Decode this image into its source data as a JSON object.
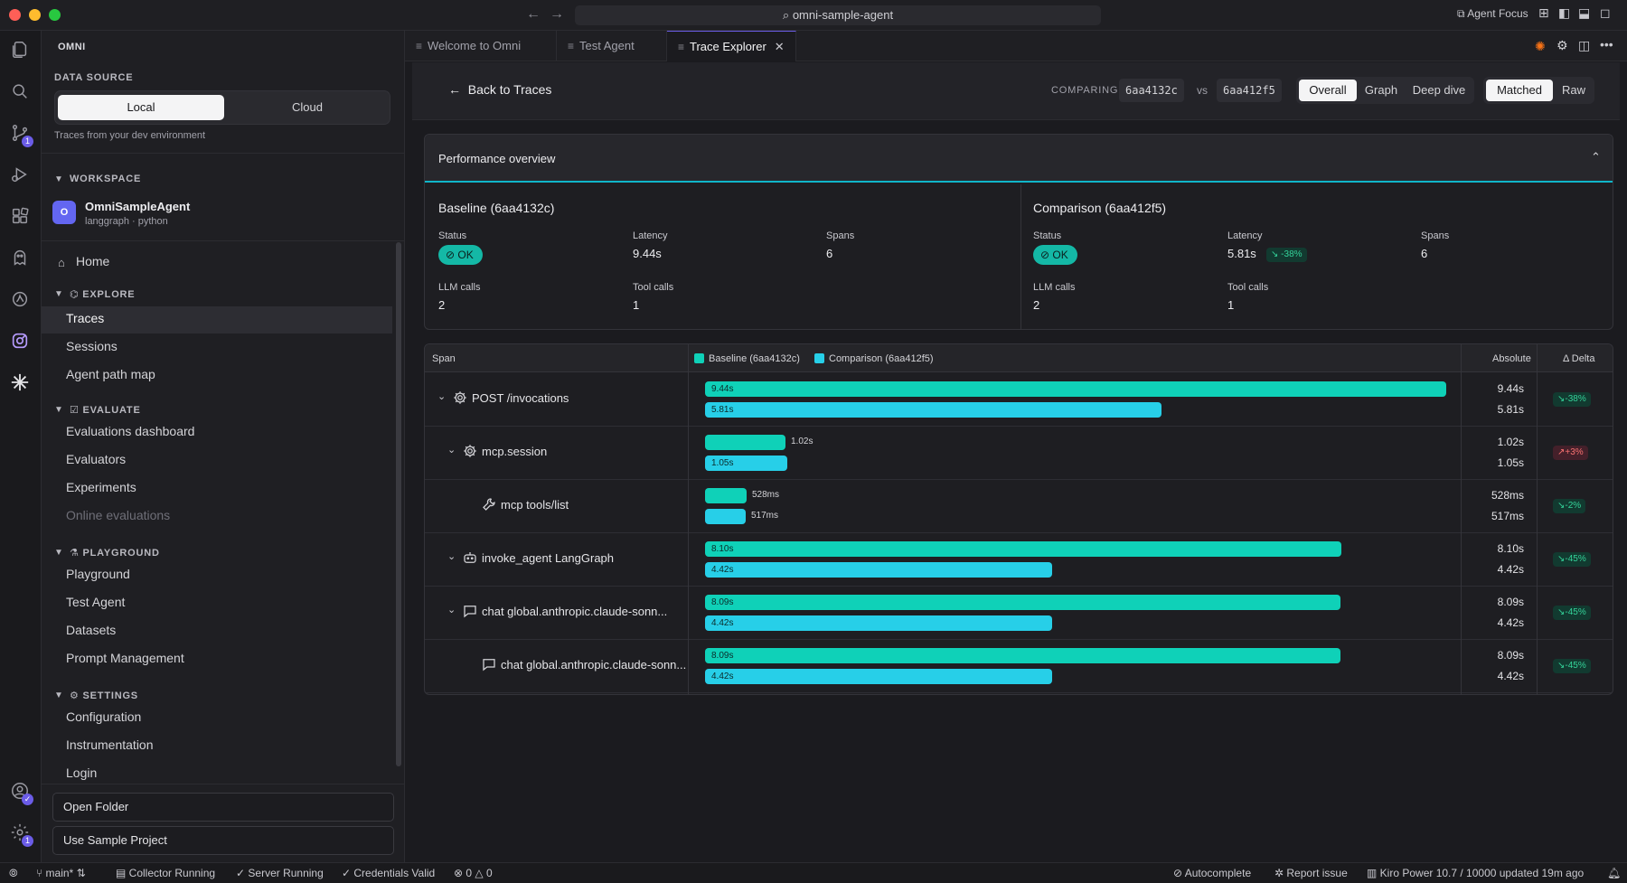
{
  "titlebar": {
    "search": "omni-sample-agent",
    "agent_focus": "Agent Focus"
  },
  "activity": {
    "source_control_badge": "1",
    "settings_badge": "1"
  },
  "sidebar": {
    "title": "OMNI",
    "data_source_label": "DATA SOURCE",
    "local_label": "Local",
    "cloud_label": "Cloud",
    "hint": "Traces from your dev environment",
    "workspace_label": "WORKSPACE",
    "workspace_avatar": "O",
    "workspace_name": "OmniSampleAgent",
    "workspace_sub": "langgraph · python",
    "home": "Home",
    "explore_label": "EXPLORE",
    "explore": [
      "Traces",
      "Sessions",
      "Agent path map"
    ],
    "evaluate_label": "EVALUATE",
    "evaluate": [
      "Evaluations dashboard",
      "Evaluators",
      "Experiments",
      "Online evaluations"
    ],
    "playground_label": "PLAYGROUND",
    "playground": [
      "Playground",
      "Test Agent",
      "Datasets",
      "Prompt Management"
    ],
    "settings_label": "SETTINGS",
    "settings": [
      "Configuration",
      "Instrumentation",
      "Login"
    ],
    "open_folder": "Open Folder",
    "use_sample": "Use Sample Project"
  },
  "tabs": [
    {
      "label": "Welcome to Omni"
    },
    {
      "label": "Test Agent"
    },
    {
      "label": "Trace Explorer"
    }
  ],
  "header": {
    "back": "Back to Traces",
    "comparing": "COMPARING",
    "hash_a": "6aa4132c",
    "vs": "vs",
    "hash_b": "6aa412f5",
    "views": [
      "Overall",
      "Graph",
      "Deep dive"
    ],
    "modes": [
      "Matched",
      "Raw"
    ]
  },
  "performance": {
    "title": "Performance overview",
    "baseline": {
      "title": "Baseline (6aa4132c)",
      "status_label": "Status",
      "status": "OK",
      "latency_label": "Latency",
      "latency": "9.44s",
      "spans_label": "Spans",
      "spans": "6",
      "llm_label": "LLM calls",
      "llm": "2",
      "tool_label": "Tool calls",
      "tool": "1"
    },
    "comparison": {
      "title": "Comparison (6aa412f5)",
      "status_label": "Status",
      "status": "OK",
      "latency_label": "Latency",
      "latency": "5.81s",
      "latency_delta": "-38%",
      "spans_label": "Spans",
      "spans": "6",
      "llm_label": "LLM calls",
      "llm": "2",
      "tool_label": "Tool calls",
      "tool": "1"
    }
  },
  "table": {
    "col_span": "Span",
    "legend_baseline": "Baseline (6aa4132c)",
    "legend_comparison": "Comparison (6aa412f5)",
    "col_absolute": "Absolute",
    "col_delta": "Δ Delta",
    "colors": {
      "baseline": "#0fd1b8",
      "comparison": "#27cfe8"
    },
    "max_seconds": 9.44,
    "rows": [
      {
        "name": "POST /invocations",
        "icon": "gear-icon",
        "indent": 0,
        "expandable": true,
        "base": 9.44,
        "comp": 5.81,
        "base_label": "9.44s",
        "comp_label": "5.81s",
        "delta": "-38%",
        "trend": "down"
      },
      {
        "name": "mcp.session",
        "icon": "gear-icon",
        "indent": 1,
        "expandable": true,
        "base": 1.02,
        "comp": 1.05,
        "base_label": "1.02s",
        "comp_label": "1.05s",
        "delta": "+3%",
        "trend": "up"
      },
      {
        "name": "mcp tools/list",
        "icon": "wrench-icon",
        "indent": 2,
        "expandable": false,
        "base": 0.528,
        "comp": 0.517,
        "base_label": "528ms",
        "comp_label": "517ms",
        "delta": "-2%",
        "trend": "down"
      },
      {
        "name": "invoke_agent LangGraph",
        "icon": "robot-icon",
        "indent": 1,
        "expandable": true,
        "base": 8.1,
        "comp": 4.42,
        "base_label": "8.10s",
        "comp_label": "4.42s",
        "delta": "-45%",
        "trend": "down"
      },
      {
        "name": "chat global.anthropic.claude-sonn...",
        "icon": "chat-icon",
        "indent": 1,
        "expandable": true,
        "base": 8.09,
        "comp": 4.42,
        "base_label": "8.09s",
        "comp_label": "4.42s",
        "delta": "-45%",
        "trend": "down"
      },
      {
        "name": "chat global.anthropic.claude-sonn...",
        "icon": "chat-icon",
        "indent": 2,
        "expandable": false,
        "base": 8.09,
        "comp": 4.42,
        "base_label": "8.09s",
        "comp_label": "4.42s",
        "delta": "-45%",
        "trend": "down"
      }
    ]
  },
  "statusbar": {
    "branch": "main*",
    "collector": "Collector Running",
    "server": "Server Running",
    "credentials": "Credentials Valid",
    "errors": "0",
    "warnings": "0",
    "autocomplete": "Autocomplete",
    "report": "Report issue",
    "power": "Kiro Power 10.7 / 10000 updated 19m ago"
  }
}
